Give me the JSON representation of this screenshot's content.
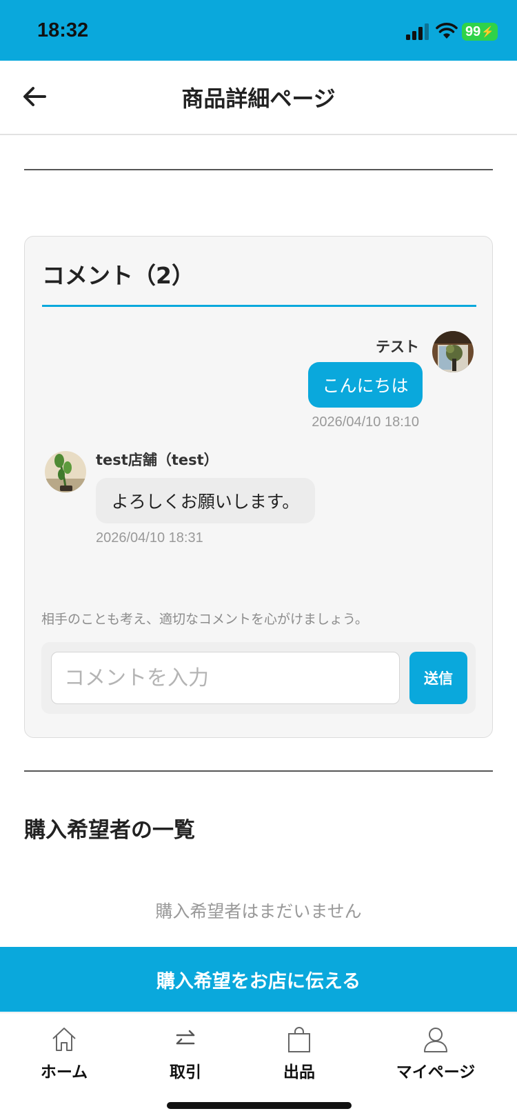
{
  "status_bar": {
    "time": "18:32",
    "battery": "99",
    "icons": [
      "signal-icon",
      "wifi-icon",
      "battery-icon"
    ]
  },
  "header": {
    "title": "商品詳細ページ",
    "back_icon": "arrow-left-icon"
  },
  "comments": {
    "heading": "コメント（2）",
    "items": [
      {
        "author": "テスト",
        "text": "こんにちは",
        "timestamp": "2026/04/10 18:10",
        "mine": true
      },
      {
        "author": "test店舗（test）",
        "text": "よろしくお願いします。",
        "timestamp": "2026/04/10 18:31",
        "mine": false
      }
    ],
    "guideline": "相手のことも考え、適切なコメントを心がけましょう。",
    "input_placeholder": "コメントを入力",
    "input_value": "",
    "send_label": "送信"
  },
  "purchase_requests": {
    "title": "購入希望者の一覧",
    "empty_text": "購入希望者はまだいません",
    "cta_label": "購入希望をお店に伝える"
  },
  "tab_bar": {
    "tabs": [
      {
        "label": "ホーム",
        "icon": "home-icon"
      },
      {
        "label": "取引",
        "icon": "swap-arrows-icon"
      },
      {
        "label": "出品",
        "icon": "shopping-bag-icon"
      },
      {
        "label": "マイページ",
        "icon": "person-icon"
      }
    ]
  },
  "colors": {
    "accent": "#0aa8dc",
    "bubble_other": "#ececec",
    "card_background": "#f6f6f6",
    "battery": "#2fd24a"
  }
}
